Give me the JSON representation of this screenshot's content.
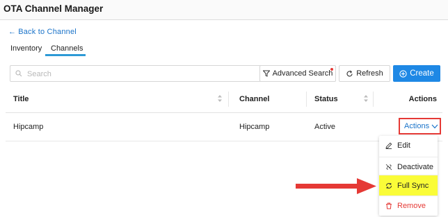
{
  "app": {
    "title": "OTA Channel Manager"
  },
  "nav": {
    "back_label": "Back to Channel"
  },
  "tabs": [
    {
      "label": "Inventory",
      "active": false
    },
    {
      "label": "Channels",
      "active": true
    }
  ],
  "toolbar": {
    "search_placeholder": "Search",
    "advanced_search_label": "Advanced Search",
    "refresh_label": "Refresh",
    "create_label": "Create"
  },
  "table": {
    "columns": [
      "Title",
      "Channel",
      "Status",
      "Actions"
    ],
    "rows": [
      {
        "title": "Hipcamp",
        "channel": "Hipcamp",
        "status": "Active",
        "actions_label": "Actions"
      }
    ]
  },
  "actions_menu": {
    "items": [
      {
        "label": "Edit",
        "icon": "pencil-icon"
      },
      {
        "label": "Deactivate",
        "icon": "unlink-icon"
      },
      {
        "label": "Full Sync",
        "icon": "sync-icon",
        "highlighted": true
      },
      {
        "label": "Remove",
        "icon": "trash-icon",
        "danger": true
      }
    ]
  },
  "colors": {
    "accent": "#1e88e5",
    "link": "#1a73c9",
    "highlight": "#fafc38",
    "danger": "#e53935"
  }
}
